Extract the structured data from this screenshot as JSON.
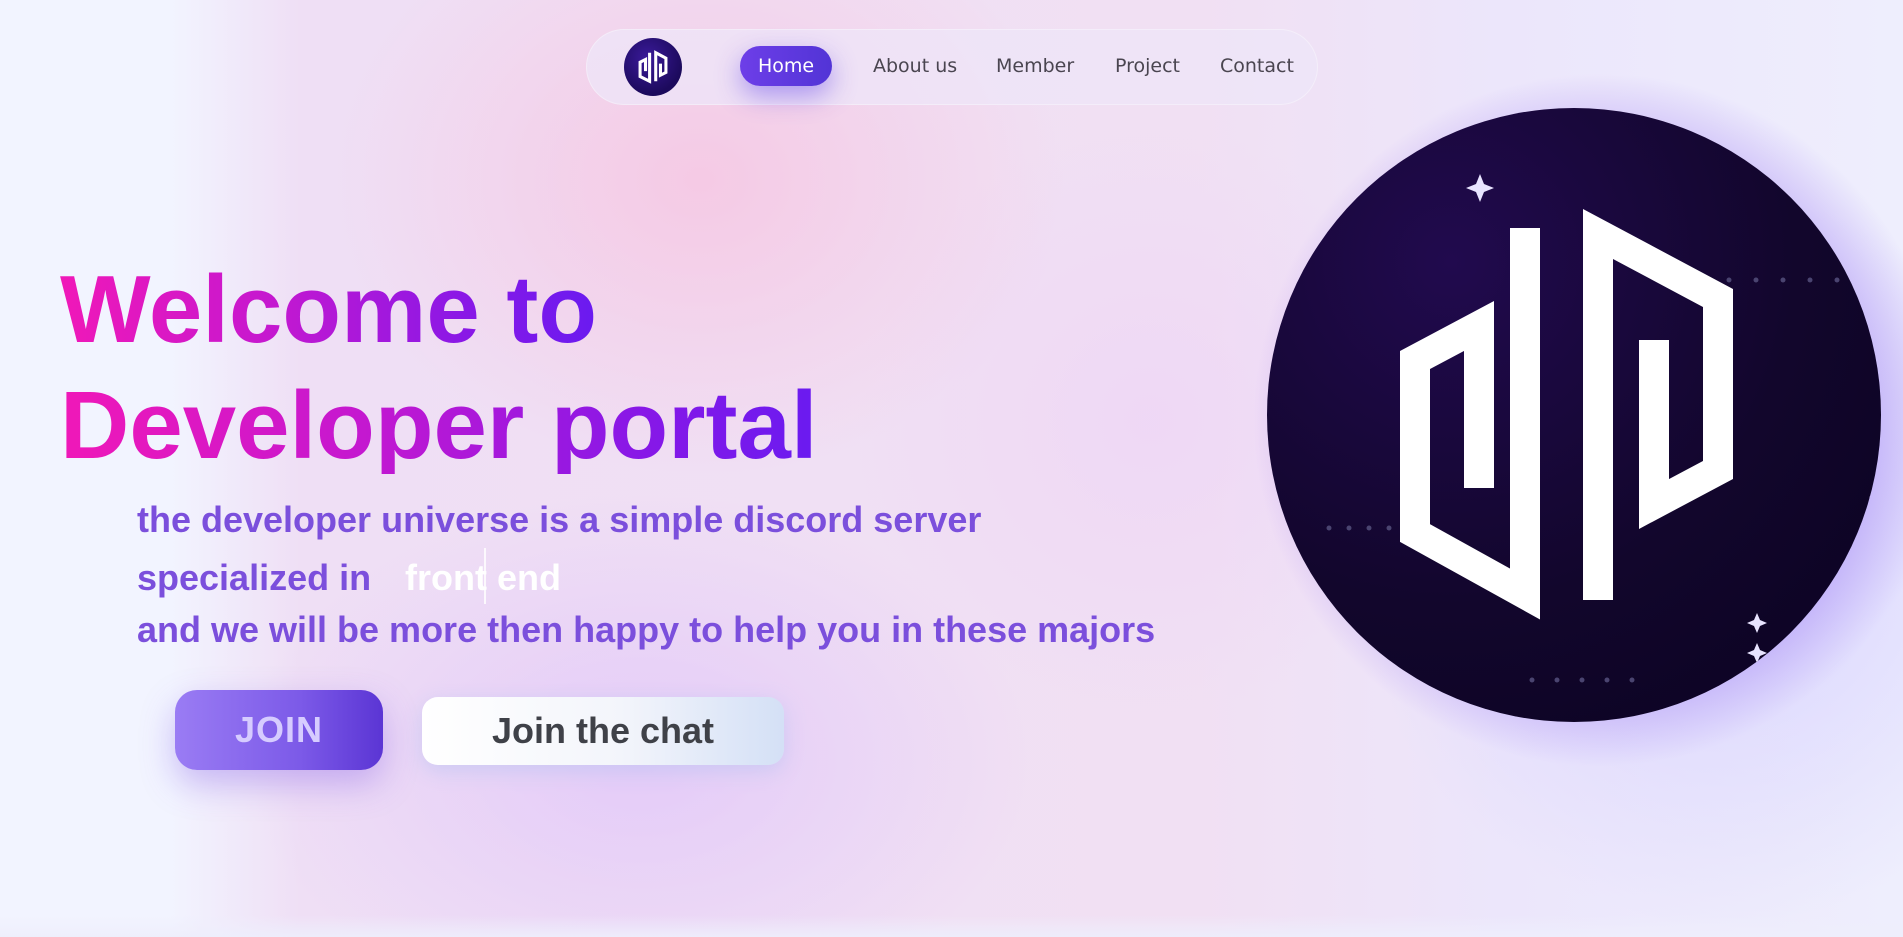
{
  "colors": {
    "accent": "#5234d6",
    "headline_gradient": [
      "#f018b8",
      "#6a1af0"
    ],
    "description": "#7b4fdc",
    "logo_bg": "#12062c"
  },
  "nav": {
    "logo_icon": "developer-portal-logo-icon",
    "items": [
      {
        "label": "Home",
        "active": true
      },
      {
        "label": "About us",
        "active": false
      },
      {
        "label": "Member",
        "active": false
      },
      {
        "label": "Project",
        "active": false
      },
      {
        "label": "Contact",
        "active": false
      }
    ]
  },
  "hero": {
    "title_line1": "Welcome to",
    "title_line2": "Developer portal",
    "description_line1": "the developer universe is a simple discord server",
    "description_line2": "specialized in",
    "typed_text": "front end",
    "description_line3": "and we will be more then happy to help you in these majors",
    "join_label": "JOIN",
    "chat_label": "Join the chat"
  },
  "hero_logo": {
    "icon": "developer-portal-logo-icon"
  }
}
